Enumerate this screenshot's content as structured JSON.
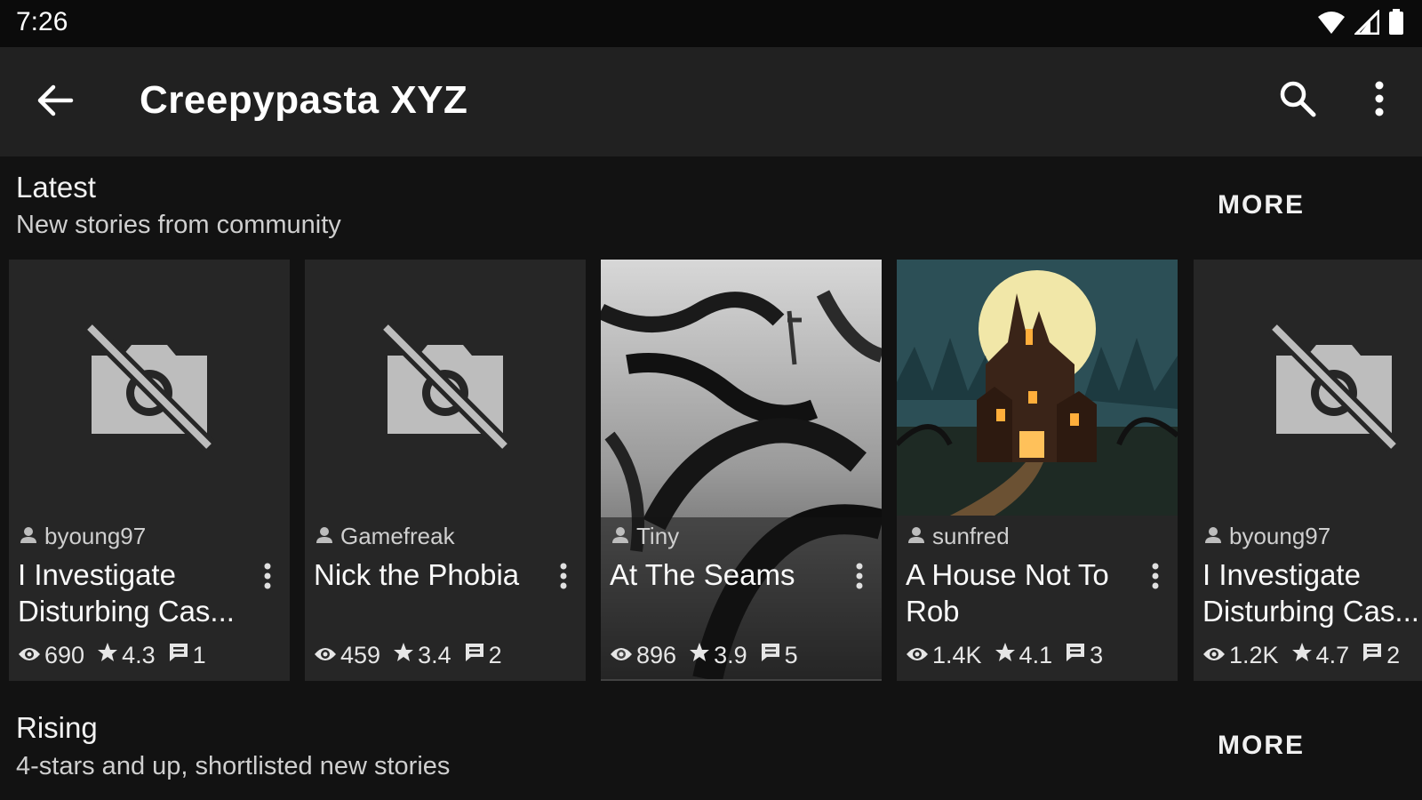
{
  "status_bar": {
    "time": "7:26"
  },
  "app_bar": {
    "title": "Creepypasta XYZ"
  },
  "sections": [
    {
      "title": "Latest",
      "subtitle": "New stories from community",
      "more_label": "MORE"
    },
    {
      "title": "Rising",
      "subtitle": "4-stars and up, shortlisted new stories",
      "more_label": "MORE"
    }
  ],
  "cards": [
    {
      "author": "byoung97",
      "title": "I Investigate Disturbing Cas...",
      "views": "690",
      "rating": "4.3",
      "comments": "1",
      "image": "no-image-icon"
    },
    {
      "author": "Gamefreak",
      "title": "Nick the Phobia",
      "views": "459",
      "rating": "3.4",
      "comments": "2",
      "image": "no-image-icon"
    },
    {
      "author": "Tiny",
      "title": "At The Seams",
      "views": "896",
      "rating": "3.9",
      "comments": "5",
      "image": "dark-tree-artwork"
    },
    {
      "author": "sunfred",
      "title": "A House Not To Rob",
      "views": "1.4K",
      "rating": "4.1",
      "comments": "3",
      "image": "haunted-house-artwork"
    },
    {
      "author": "byoung97",
      "title": "I Investigate Disturbing Cas...",
      "views": "1.2K",
      "rating": "4.7",
      "comments": "2",
      "image": "no-image-icon"
    }
  ],
  "colors": {
    "background": "#121212",
    "app_bar": "#212121",
    "card": "#262626"
  }
}
